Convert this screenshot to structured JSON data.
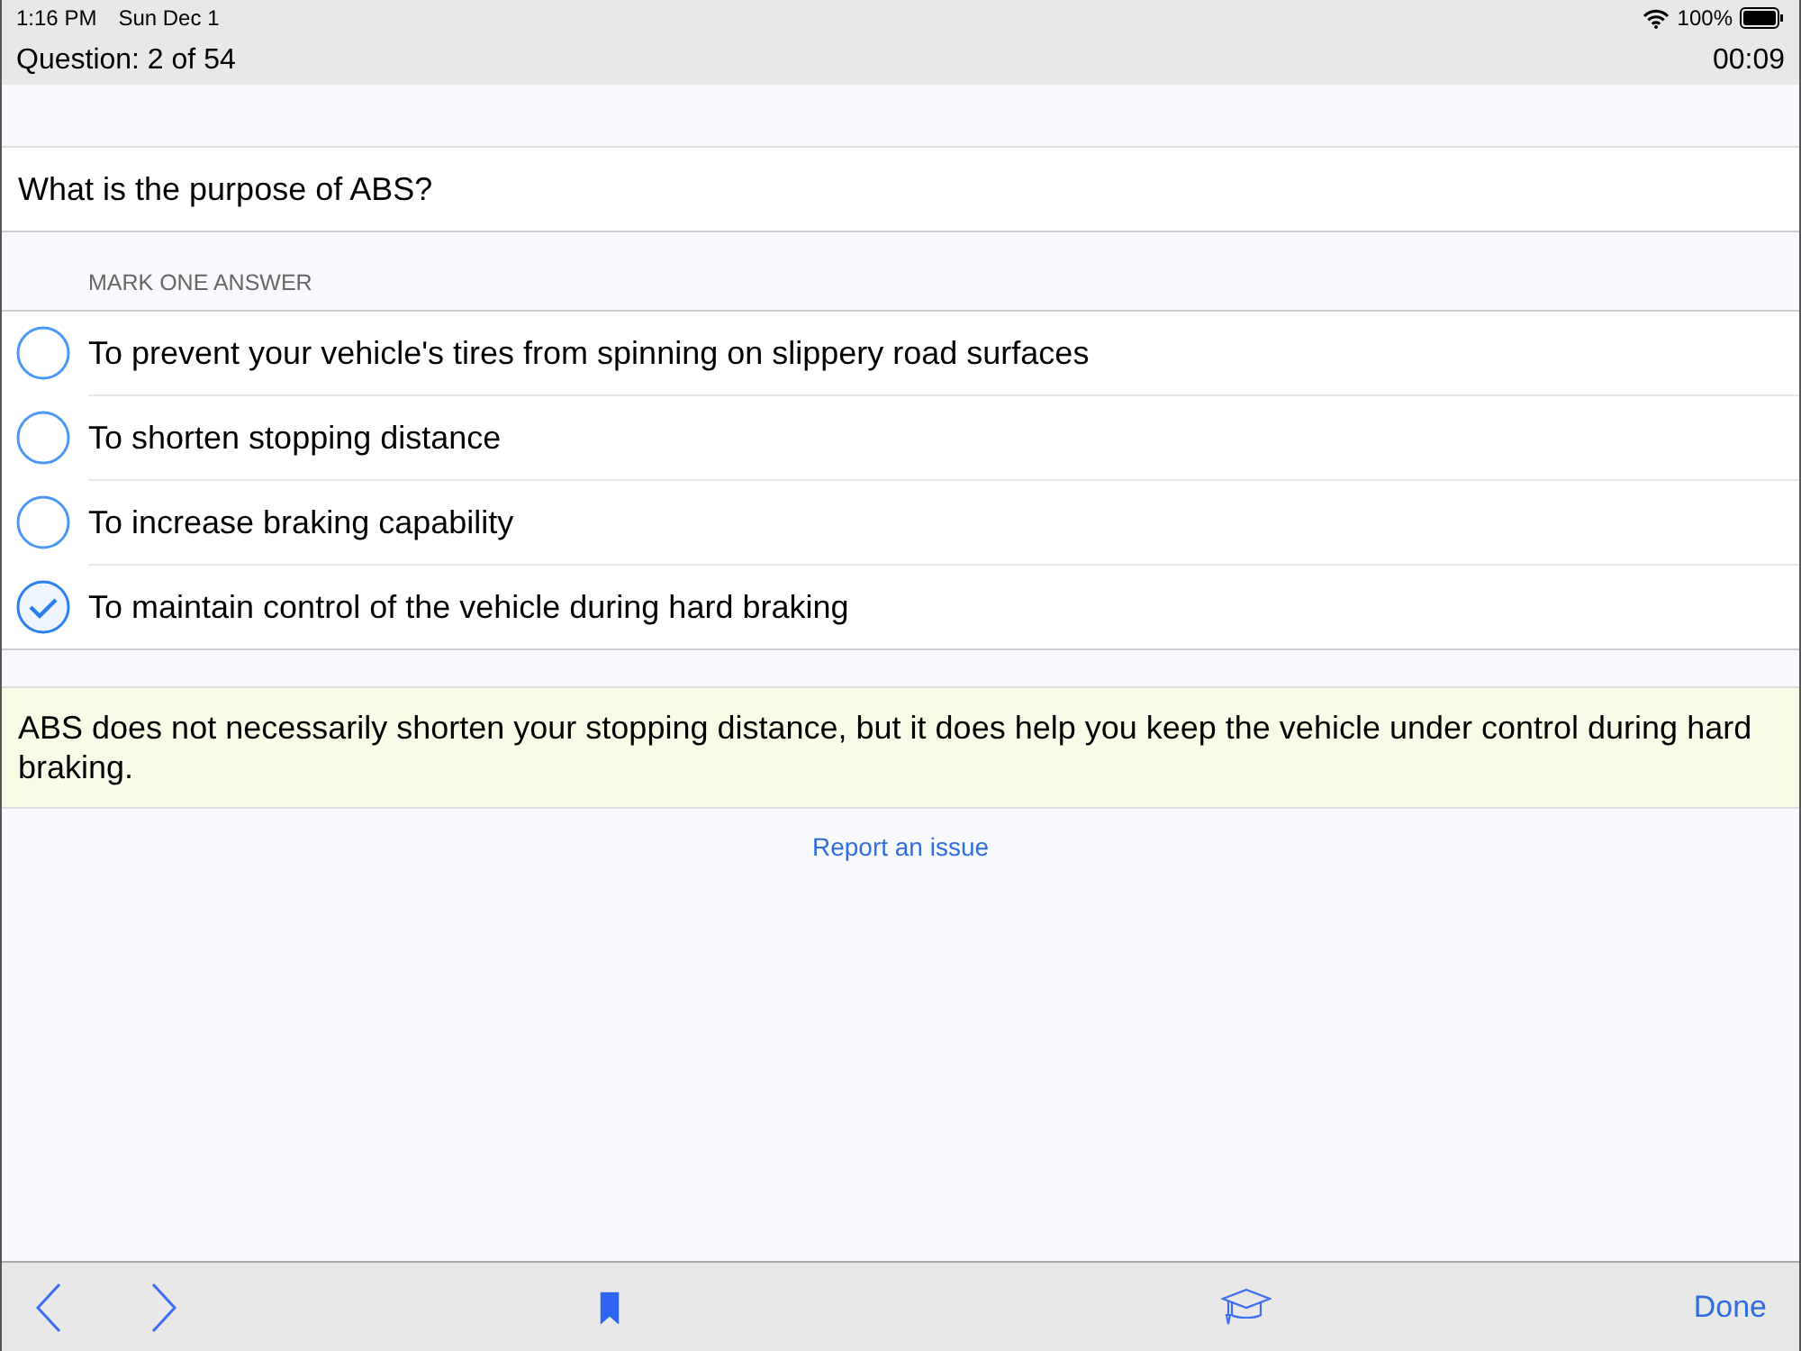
{
  "status_bar": {
    "time": "1:16 PM",
    "date": "Sun Dec 1",
    "battery": "100%"
  },
  "header": {
    "title": "Question: 2 of 54",
    "timer": "00:09"
  },
  "question": "What is the purpose of ABS?",
  "section_label": "MARK ONE ANSWER",
  "answers": [
    {
      "text": "To prevent your vehicle's tires from spinning on slippery road surfaces",
      "selected": false
    },
    {
      "text": "To shorten stopping distance",
      "selected": false
    },
    {
      "text": "To increase braking capability",
      "selected": false
    },
    {
      "text": "To maintain control of the vehicle during hard braking",
      "selected": true
    }
  ],
  "explanation": "ABS does not necessarily shorten your stopping distance, but it does help you keep the vehicle under control during hard braking.",
  "report_link": "Report an issue",
  "toolbar": {
    "bookmarked": true,
    "done": "Done"
  }
}
